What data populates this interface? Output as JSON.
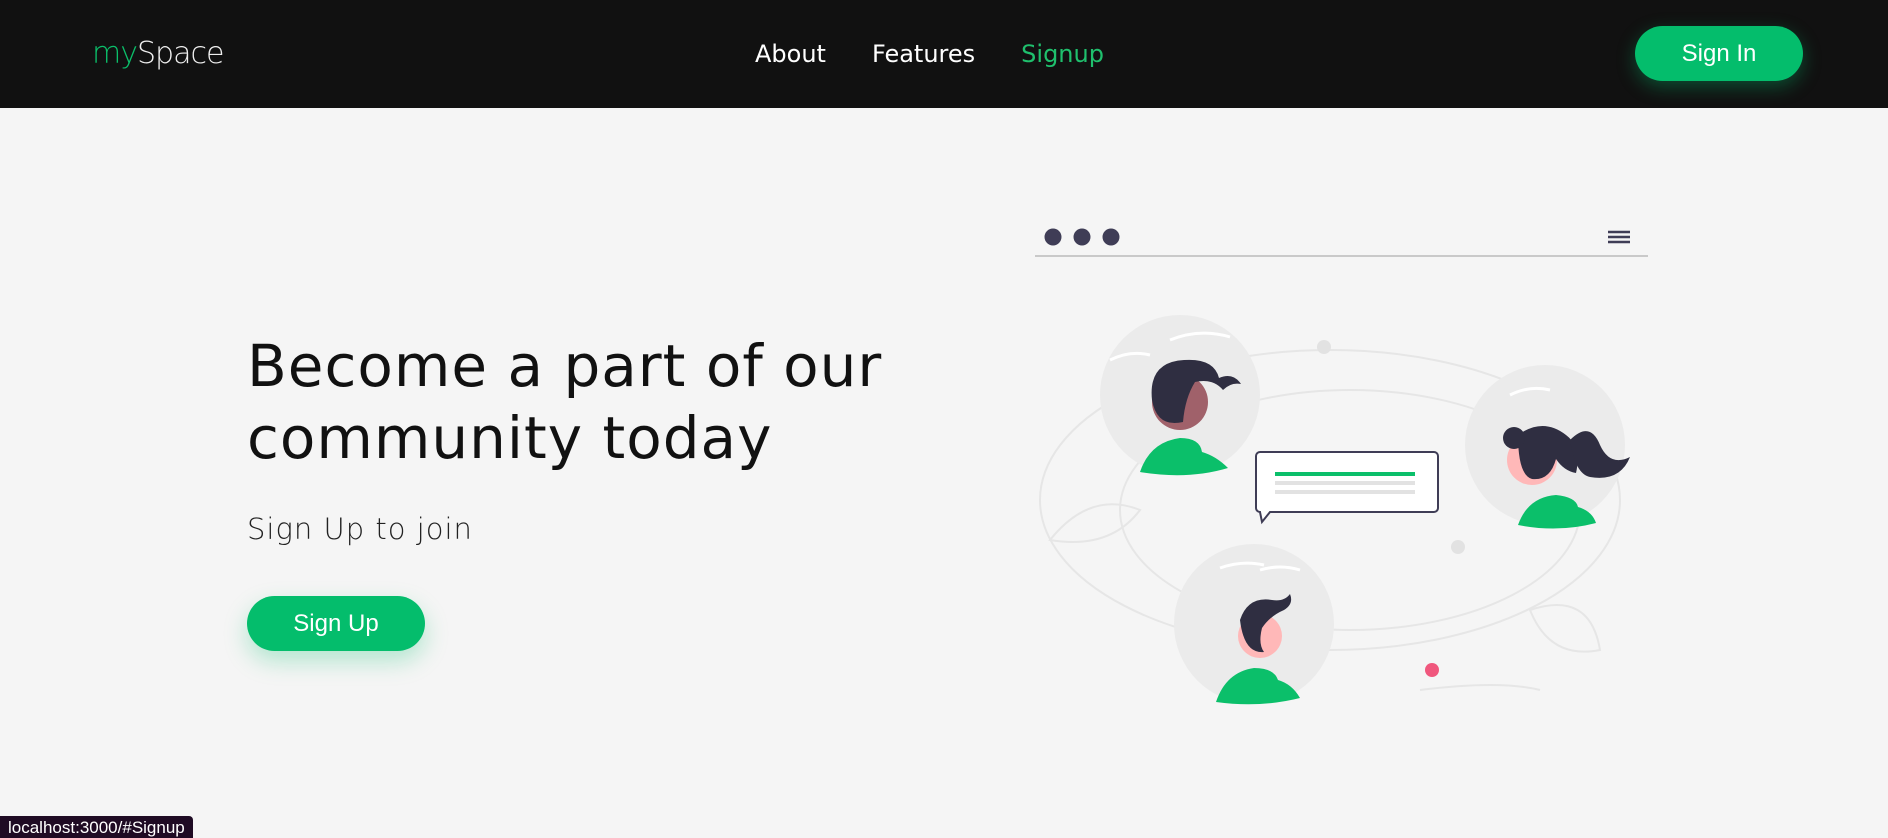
{
  "navbar": {
    "logo": {
      "part1": "my",
      "part2": "Space"
    },
    "links": [
      {
        "label": "About"
      },
      {
        "label": "Features"
      },
      {
        "label": "Signup",
        "active": true
      }
    ],
    "signin_label": "Sign In"
  },
  "hero": {
    "title_line1": "Become a part of our",
    "title_line2": "community today",
    "subtitle": "Sign Up to join",
    "signup_label": "Sign Up"
  },
  "illustration": {
    "icons": [
      "window-dots-icon",
      "hamburger-menu-icon",
      "avatar-man-icon",
      "avatar-woman-icon",
      "avatar-boy-icon",
      "chat-bubble-icon"
    ]
  },
  "status_bar": {
    "url": "localhost:3000/#Signup"
  },
  "colors": {
    "accent": "#04bd6c",
    "nav_bg": "#111111",
    "page_bg": "#f5f5f5",
    "dark_figure": "#3f3d56",
    "dot_pink": "#f0577d"
  }
}
